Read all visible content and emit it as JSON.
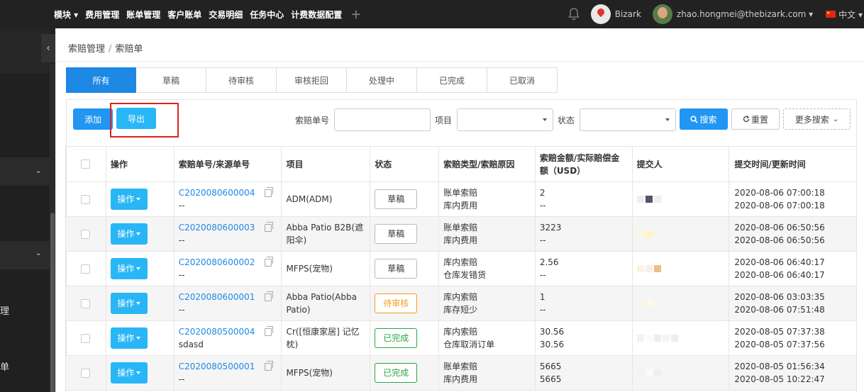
{
  "topnav": {
    "menu": [
      "模块 ▾",
      "费用管理",
      "账单管理",
      "客户账单",
      "交易明细",
      "任务中心",
      "计费数据配置"
    ],
    "add_icon": "plus-icon",
    "user1": "Bizark",
    "user2": "zhao.hongmei@thebizark.com ▾",
    "lang": "中文 ▾"
  },
  "sidebar": {
    "items": [
      "理",
      "单"
    ]
  },
  "breadcrumb": {
    "parent": "索赔管理",
    "sep": "/",
    "current": "索赔单"
  },
  "tabs": [
    "所有",
    "草稿",
    "待审核",
    "审核拒回",
    "处理中",
    "已完成",
    "已取消"
  ],
  "toolbar": {
    "add": "添加",
    "export": "导出",
    "claim_no_label": "索赔单号",
    "claim_no_value": "",
    "project_label": "项目",
    "status_label": "状态",
    "search": "搜索",
    "reset": "重置",
    "more": "更多搜索"
  },
  "table": {
    "headers": [
      "",
      "操作",
      "索赔单号/来源单号",
      "项目",
      "状态",
      "索赔类型/索赔原因",
      "索赔金额/实际赔偿金额（USD）",
      "提交人",
      "提交时间/更新时间"
    ],
    "op_label": "操作",
    "rows": [
      {
        "no": "C2020080600004",
        "src": "--",
        "project": "ADM(ADM)",
        "status": "草稿",
        "type": "账单索赔",
        "reason": "库内费用",
        "amount": "2",
        "actual": "--",
        "created": "2020-08-06 07:00:18",
        "updated": "2020-08-06 07:00:18"
      },
      {
        "no": "C2020080600003",
        "src": "--",
        "project": "Abba Patio B2B(遮阳伞)",
        "status": "草稿",
        "type": "账单索赔",
        "reason": "库内费用",
        "amount": "3223",
        "actual": "--",
        "created": "2020-08-06 06:50:56",
        "updated": "2020-08-06 06:50:56"
      },
      {
        "no": "C2020080600002",
        "src": "--",
        "project": "MFPS(宠物)",
        "status": "草稿",
        "type": "库内索赔",
        "reason": "仓库发错货",
        "amount": "2.56",
        "actual": "--",
        "created": "2020-08-06 06:40:17",
        "updated": "2020-08-06 06:40:17"
      },
      {
        "no": "C2020080600001",
        "src": "--",
        "project": "Abba Patio(Abba Patio)",
        "status": "待审核",
        "type": "库内索赔",
        "reason": "库存短少",
        "amount": "1",
        "actual": "--",
        "created": "2020-08-06 03:03:35",
        "updated": "2020-08-06 07:51:48"
      },
      {
        "no": "C2020080500004",
        "src": "sdasd",
        "project": "Cr([恒康家居] 记忆枕)",
        "status": "已完成",
        "type": "库内索赔",
        "reason": "仓库取消订单",
        "amount": "30.56",
        "actual": "30.56",
        "created": "2020-08-05 07:37:38",
        "updated": "2020-08-05 07:37:56"
      },
      {
        "no": "C2020080500001",
        "src": "--",
        "project": "MFPS(宠物)",
        "status": "已完成",
        "type": "账单索赔",
        "reason": "库内费用",
        "amount": "5665",
        "actual": "5665",
        "created": "2020-08-05 01:56:34",
        "updated": "2020-08-05 10:22:47"
      }
    ]
  },
  "colors": {
    "primary": "#2196f3",
    "cyan": "#29b6f6",
    "highlight": "#e02020",
    "pending": "#f0a020",
    "done": "#28a745"
  }
}
